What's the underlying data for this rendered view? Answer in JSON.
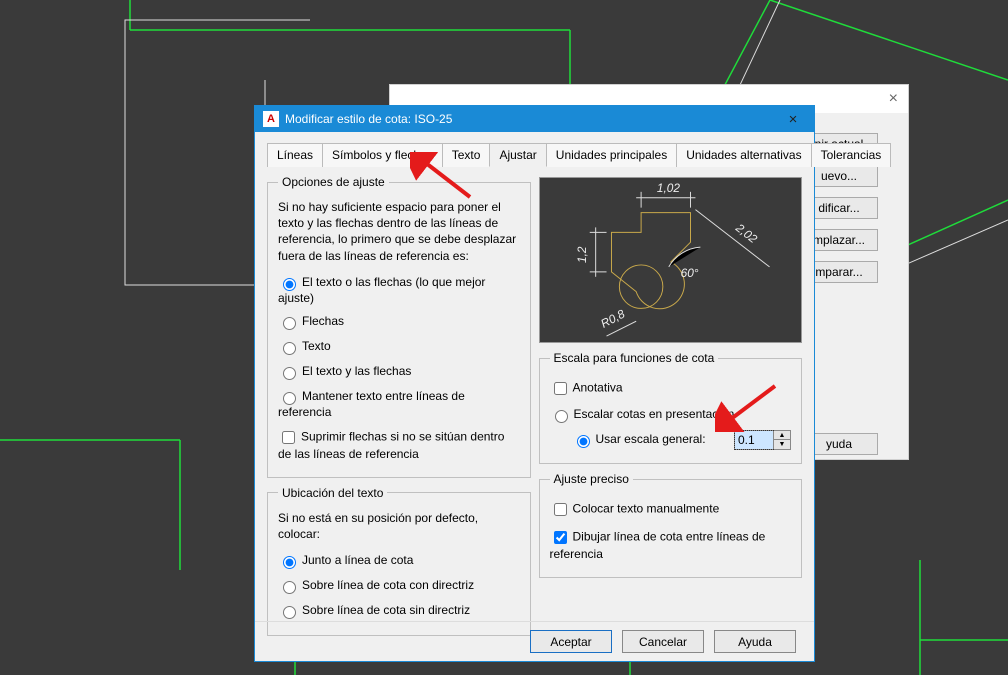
{
  "background_dialog": {
    "close_glyph": "×",
    "buttons": {
      "set_current": "nir actual",
      "new": "uevo...",
      "modify": "dificar...",
      "override": "mplazar...",
      "compare": "mparar..."
    },
    "help": "yuda"
  },
  "dialog": {
    "app_icon_letter": "A",
    "title": "Modificar estilo de cota: ISO-25",
    "close_glyph": "×",
    "tabs": {
      "lines": "Líneas",
      "symbols": "Símbolos y flechas",
      "text": "Texto",
      "fit": "Ajustar",
      "primary": "Unidades principales",
      "alternate": "Unidades alternativas",
      "tolerances": "Tolerancias"
    },
    "fit_options": {
      "legend": "Opciones de ajuste",
      "intro": "Si no hay suficiente espacio para poner el texto y las flechas dentro de las líneas de referencia, lo primero que se debe desplazar fuera de las líneas de referencia es:",
      "opt_either": "El texto o las flechas (lo que mejor ajuste)",
      "opt_arrows": "Flechas",
      "opt_text": "Texto",
      "opt_both": "El texto y las flechas",
      "opt_keep": "Mantener texto entre líneas de referencia",
      "suppress": "Suprimir flechas si no se sitúan dentro de las líneas de referencia"
    },
    "text_placement": {
      "legend": "Ubicación del texto",
      "intro": "Si no está en su posición por defecto, colocar:",
      "opt_beside": "Junto a línea de cota",
      "opt_leader": "Sobre línea de cota con directriz",
      "opt_noleader": "Sobre línea de cota sin directriz"
    },
    "preview": {
      "dim_top": "1,02",
      "dim_left": "1,2",
      "dim_diag": "2,02",
      "dim_angle": "60°",
      "dim_radius": "R0,8"
    },
    "scale": {
      "legend": "Escala para funciones de cota",
      "annotative": "Anotativa",
      "layout": "Escalar cotas en presentación",
      "overall": "Usar escala general:",
      "value": "0.1"
    },
    "fine": {
      "legend": "Ajuste preciso",
      "manual": "Colocar texto manualmente",
      "draw_line": "Dibujar línea de cota entre líneas de referencia"
    },
    "buttons": {
      "ok": "Aceptar",
      "cancel": "Cancelar",
      "help": "Ayuda"
    }
  }
}
